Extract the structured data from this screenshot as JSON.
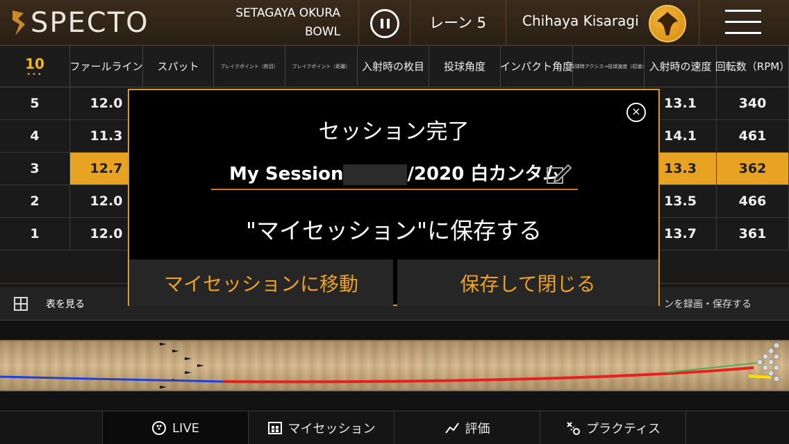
{
  "header": {
    "logo_text": "SPECTO",
    "venue_line1": "SETAGAYA OKURA",
    "venue_line2": "BOWL",
    "lane": "レーン 5",
    "user_name": "Chihaya Kisaragi"
  },
  "table": {
    "shot_count": "10",
    "columns": [
      "ファールライン",
      "スパット",
      "ブレイクポイント（枚目）",
      "ブレイクポイント（距離）",
      "入射時の枚目",
      "投球角度",
      "インパクト角度",
      "投球時アクシス→投球速度（初速）",
      "入射時の速度",
      "回転数（RPM）"
    ],
    "rows": [
      {
        "no": "5",
        "foul": "12.0",
        "speed": "13.1",
        "rpm": "340",
        "highlight": false
      },
      {
        "no": "4",
        "foul": "11.3",
        "speed": "14.1",
        "rpm": "461",
        "highlight": false
      },
      {
        "no": "3",
        "foul": "12.7",
        "speed": "13.3",
        "rpm": "362",
        "highlight": true
      },
      {
        "no": "2",
        "foul": "12.0",
        "speed": "13.5",
        "rpm": "466",
        "highlight": false
      },
      {
        "no": "1",
        "foul": "12.0",
        "speed": "13.7",
        "rpm": "361",
        "highlight": false
      }
    ]
  },
  "toolbar": {
    "view_table": "表を見る",
    "record_save": "ンを録画・保存する"
  },
  "modal": {
    "title": "セッション完了",
    "session_name_prefix": "My Session",
    "session_name_suffix": "/2020 白カンタム",
    "save_message": "\"マイセッション\"に保存する",
    "go_button": "マイセッションに移動",
    "save_close_button": "保存して閉じる",
    "close_symbol": "×"
  },
  "bottom_nav": {
    "live": "LIVE",
    "my_session": "マイセッション",
    "rating": "評価",
    "practice": "プラクティス"
  },
  "colors": {
    "accent": "#e9a322",
    "modal_button_text": "#f0a122",
    "trajectory_pre": "#1f3fd8",
    "trajectory_post": "#e8201e"
  }
}
